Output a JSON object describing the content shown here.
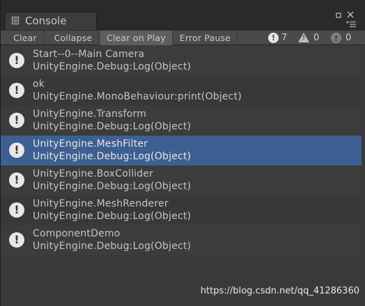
{
  "window": {
    "tab_title": "Console",
    "icons": {
      "tab": "console-icon",
      "maximize": "maximize-icon",
      "close": "close-icon",
      "menu": "menu-icon"
    }
  },
  "toolbar": {
    "buttons": [
      {
        "label": "Clear",
        "active": false
      },
      {
        "label": "Collapse",
        "active": false
      },
      {
        "label": "Clear on Play",
        "active": true
      },
      {
        "label": "Error Pause",
        "active": false
      }
    ],
    "counters": {
      "info": "7",
      "warning": "0",
      "error": "0"
    }
  },
  "logs": [
    {
      "message": "Start--0--Main Camera",
      "source": "UnityEngine.Debug:Log(Object)",
      "selected": false,
      "icon": "info-icon"
    },
    {
      "message": "ok",
      "source": "UnityEngine.MonoBehaviour:print(Object)",
      "selected": false,
      "icon": "info-icon"
    },
    {
      "message": "UnityEngine.Transform",
      "source": "UnityEngine.Debug:Log(Object)",
      "selected": false,
      "icon": "info-icon"
    },
    {
      "message": "UnityEngine.MeshFilter",
      "source": "UnityEngine.Debug:Log(Object)",
      "selected": true,
      "icon": "info-icon"
    },
    {
      "message": "UnityEngine.BoxCollider",
      "source": "UnityEngine.Debug:Log(Object)",
      "selected": false,
      "icon": "info-icon"
    },
    {
      "message": "UnityEngine.MeshRenderer",
      "source": "UnityEngine.Debug:Log(Object)",
      "selected": false,
      "icon": "info-icon"
    },
    {
      "message": "ComponentDemo",
      "source": "UnityEngine.Debug:Log(Object)",
      "selected": false,
      "icon": "info-icon"
    }
  ],
  "watermark": "https://blog.csdn.net/qq_41286360",
  "colors": {
    "selection": "#3d5f91",
    "panel": "#3a3a3a",
    "toolbar": "#4a4a4a"
  }
}
